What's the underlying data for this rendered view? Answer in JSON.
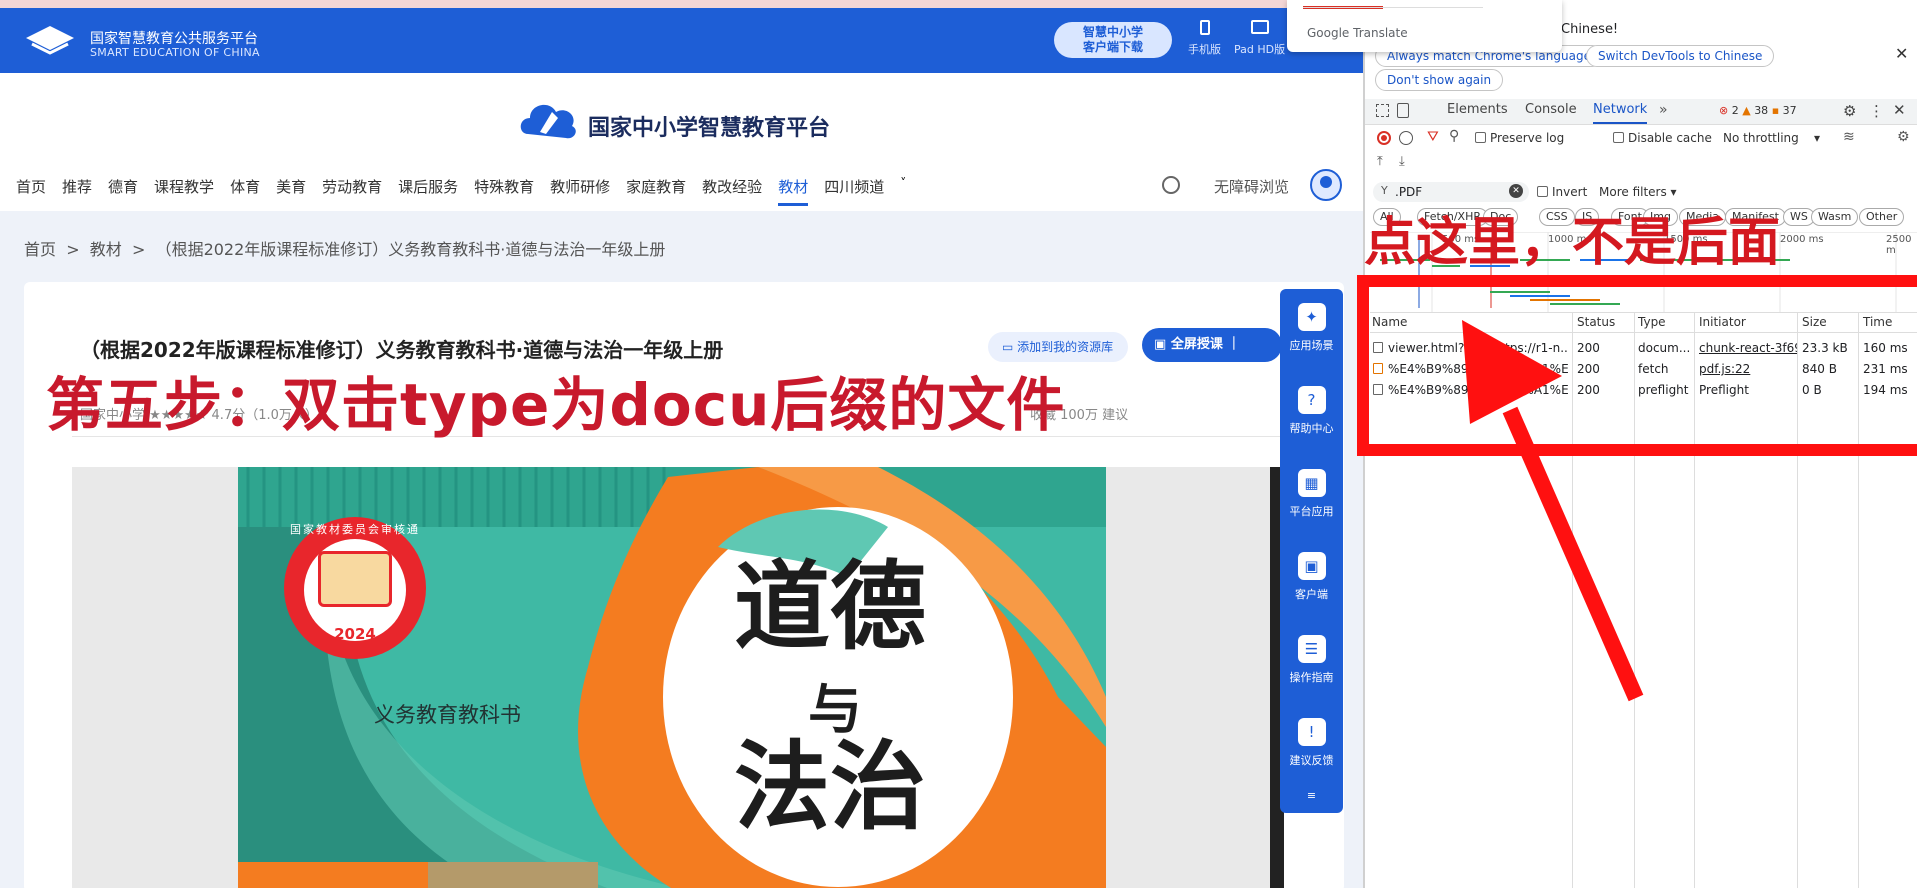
{
  "site": {
    "logo_cn": "国家智慧教育公共服务平台",
    "logo_en": "SMART EDUCATION OF CHINA",
    "download_label": "智慧中小学\n客户端下载",
    "device_phone": "手机版",
    "device_pad": "Pad HD版",
    "brand": "国家中小学智慧教育平台",
    "nav": [
      "首页",
      "推荐",
      "德育",
      "课程教学",
      "体育",
      "美育",
      "劳动教育",
      "课后服务",
      "特殊教育",
      "教师研修",
      "家庭教育",
      "教改经验",
      "教材",
      "四川频道"
    ],
    "nav_active": "教材",
    "accessibility": "无障碍浏览",
    "breadcrumb": [
      "首页",
      "教材",
      "（根据2022年版课程标准修订）义务教育教科书·道德与法治一年级上册"
    ],
    "doc_title": "（根据2022年版课程标准修订）义务教育教科书·道德与法治一年级上册",
    "add_resource": "添加到我的资源库",
    "fullscreen_teach": "全屏授课",
    "meta_left": "国家中小学  ★★★★★ 4.7分（1.0万人）",
    "meta_right": "收藏   100万    建议",
    "sidebar": [
      {
        "label": "应用场景",
        "icon": "grid-icon"
      },
      {
        "label": "帮助中心",
        "icon": "help-icon"
      },
      {
        "label": "平台应用",
        "icon": "apps-icon"
      },
      {
        "label": "客户端",
        "icon": "client-icon"
      },
      {
        "label": "操作指南",
        "icon": "guide-icon"
      },
      {
        "label": "建议反馈",
        "icon": "feedback-icon"
      }
    ],
    "cover": {
      "seal_text": "国家教材委员会审核通过",
      "seal_year": "2024",
      "subtitle": "义务教育教科书",
      "title_1": "道德",
      "title_2": "与",
      "title_3": "法治"
    }
  },
  "annotations": {
    "step5": "第五步：双击type为docu后缀的文件",
    "click_here": "点这里，不是后面"
  },
  "google_translate": {
    "label": "Google Translate",
    "chinese_prompt": "Chinese!",
    "always_match": "Always match Chrome's language",
    "switch_devtools": "Switch DevTools to Chinese",
    "dont_show": "Don't show again"
  },
  "devtools": {
    "tabs": [
      "Elements",
      "Console",
      "Network"
    ],
    "active_tab": "Network",
    "errors": "2",
    "warnings": "38",
    "issues": "37",
    "preserve_log": "Preserve log",
    "disable_cache": "Disable cache",
    "throttling": "No throttling",
    "filter_value": ".PDF",
    "invert": "Invert",
    "more_filters": "More filters",
    "type_filters": [
      "All",
      "Fetch/XHR",
      "Doc",
      "CSS",
      "JS",
      "Font",
      "Img",
      "Media",
      "Manifest",
      "WS",
      "Wasm",
      "Other"
    ],
    "timeline_ticks": [
      "500 ms",
      "1000 ms",
      "1500 ms",
      "2000 ms",
      "2500 m"
    ],
    "columns": [
      "Name",
      "Status",
      "Type",
      "Initiator",
      "Size",
      "Time"
    ],
    "rows": [
      {
        "name": "viewer.html?file=https://r1-n...",
        "status": "200",
        "type": "docum...",
        "initiator": "chunk-react-3f69",
        "size": "23.3 kB",
        "time": "160 ms"
      },
      {
        "name": "%E4%B9%89%E5%8A%A1%E...",
        "status": "200",
        "type": "fetch",
        "initiator": "pdf.js:22",
        "size": "840 B",
        "time": "231 ms"
      },
      {
        "name": "%E4%B9%89%E5%8A%A1%E...",
        "status": "200",
        "type": "preflight",
        "initiator": "Preflight",
        "size": "0 B",
        "time": "194 ms"
      }
    ]
  },
  "colors": {
    "primary": "#1e5ed6",
    "annotation_red": "#d4181f",
    "cover_teal": "#3fb9a4",
    "cover_orange": "#f47c20"
  }
}
